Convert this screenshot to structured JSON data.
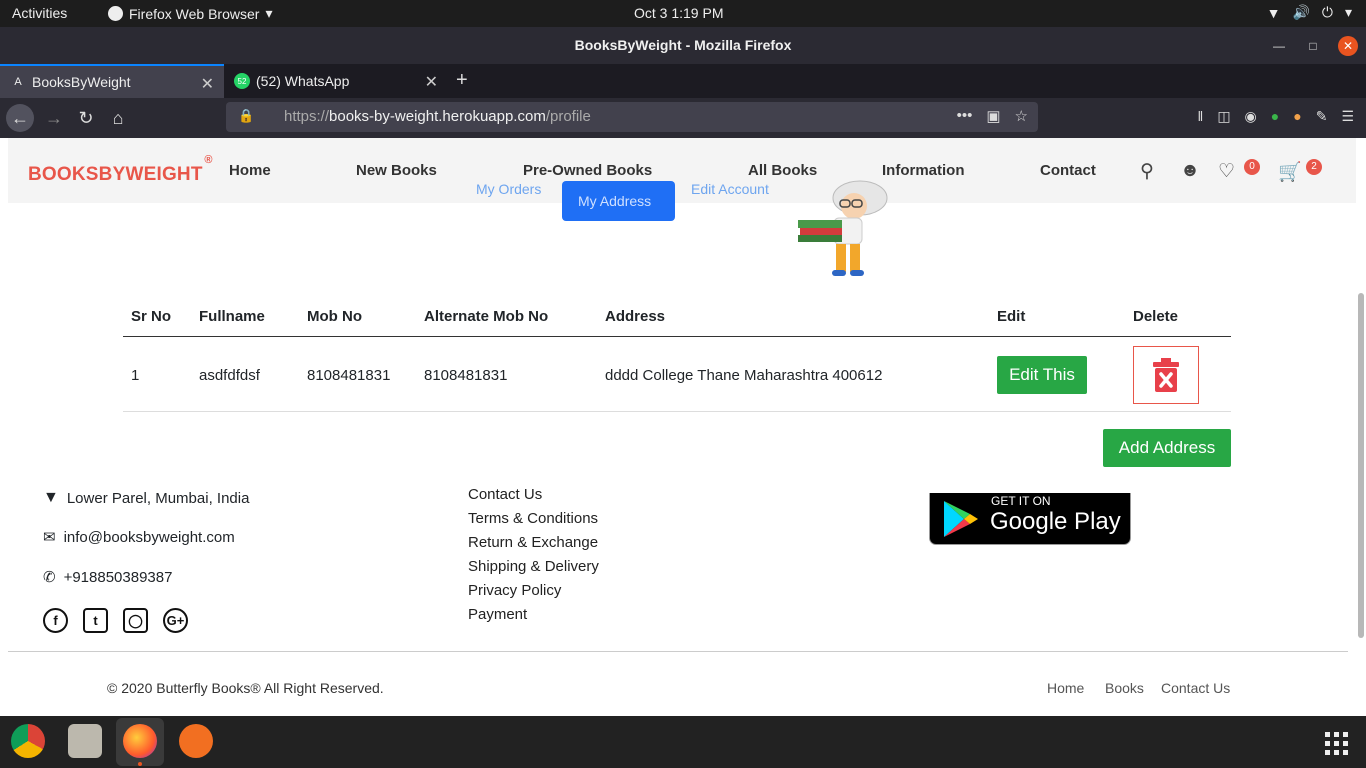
{
  "system": {
    "activities": "Activities",
    "app_menu": "Firefox Web Browser",
    "clock": "Oct 3   1:19 PM"
  },
  "window": {
    "title": "BooksByWeight - Mozilla Firefox"
  },
  "tabs": [
    {
      "label": "BooksByWeight",
      "icon": "angular-icon"
    },
    {
      "label": "(52) WhatsApp",
      "icon": "whatsapp-icon",
      "badge": "52"
    }
  ],
  "urlbar": {
    "scheme": "https://",
    "host": "books-by-weight.herokuapp.com",
    "path": "/profile",
    "more": "•••"
  },
  "site": {
    "logo": "BOOKSBYWEIGHT",
    "logo_mark": "®",
    "menu": [
      "Home",
      "New Books",
      "Pre-Owned Books",
      "All Books",
      "Information",
      "Contact"
    ],
    "wishlist_count": "0",
    "cart_count": "2",
    "subtabs": [
      "My Orders",
      "My Address",
      "Edit Account"
    ]
  },
  "table": {
    "headers": [
      "Sr No",
      "Fullname",
      "Mob No",
      "Alternate Mob No",
      "Address",
      "Edit",
      "Delete"
    ],
    "rows": [
      {
        "sr": "1",
        "fullname": "asdfdfdsf",
        "mob": "8108481831",
        "alt_mob": "8108481831",
        "address": "dddd College Thane Maharashtra 400612",
        "edit_label": "Edit This"
      }
    ],
    "add_label": "Add Address"
  },
  "footer": {
    "address": "Lower Parel, Mumbai, India",
    "email": "info@booksbyweight.com",
    "phone": "+918850389387",
    "links": [
      "Contact Us",
      "Terms & Conditions",
      "Return & Exchange",
      "Shipping & Delivery",
      "Privacy Policy",
      "Payment"
    ],
    "gplay_small": "GET IT ON",
    "gplay_big": "Google Play",
    "copyright": "© 2020 Butterfly Books® All Right Reserved.",
    "bottom_links": [
      "Home",
      "Books",
      "Contact Us"
    ]
  },
  "colors": {
    "brand": "#e8564a",
    "primary": "#1f6ff5",
    "success": "#28a745"
  }
}
